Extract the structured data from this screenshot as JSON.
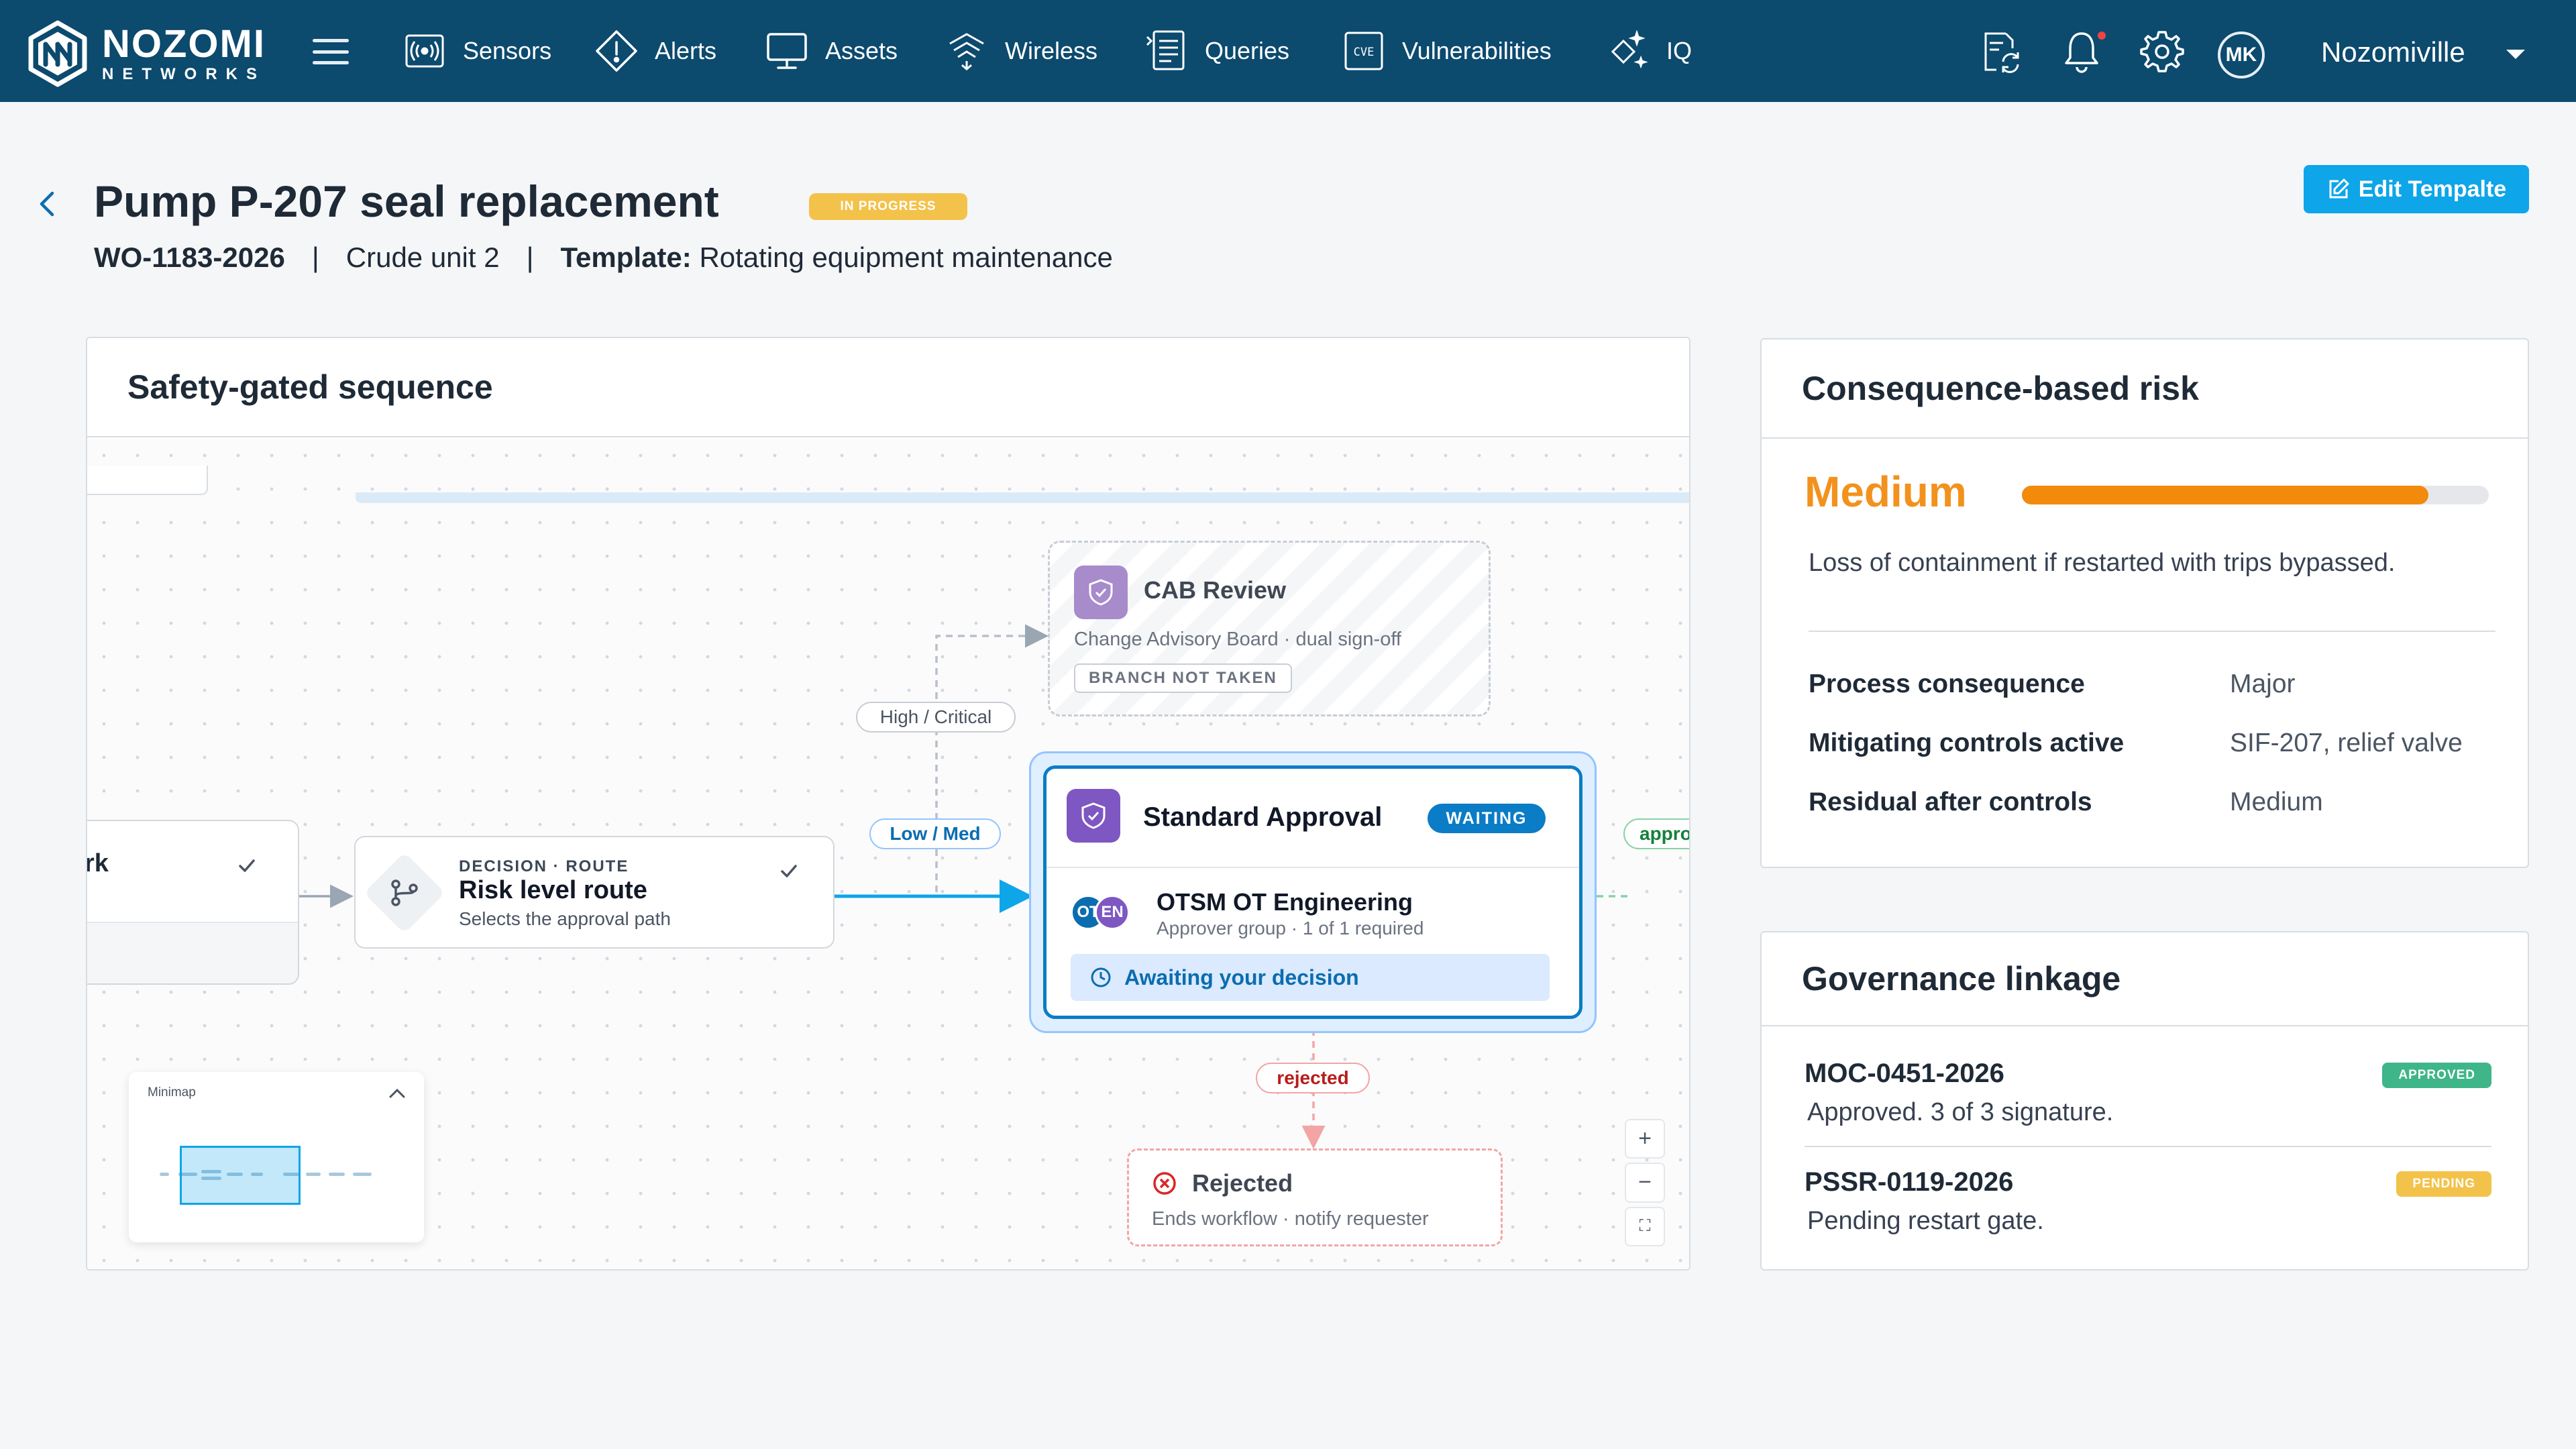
{
  "brand": {
    "name_top": "NOZOMI",
    "name_bottom": "NETWORKS"
  },
  "nav": {
    "items": [
      {
        "label": "Sensors",
        "icon": "sensor-icon"
      },
      {
        "label": "Alerts",
        "icon": "alert-icon"
      },
      {
        "label": "Assets",
        "icon": "monitor-icon"
      },
      {
        "label": "Wireless",
        "icon": "wireless-icon"
      },
      {
        "label": "Queries",
        "icon": "queries-icon"
      },
      {
        "label": "Vulnerabilities",
        "icon": "cve-icon"
      },
      {
        "label": "IQ",
        "icon": "iq-icon"
      }
    ],
    "cve_text": "CVE",
    "avatar_initials": "MK",
    "tenant": "Nozomiville"
  },
  "header": {
    "title": "Pump P-207 seal replacement",
    "status": "IN PROGRESS",
    "work_order": "WO-1183-2026",
    "unit": "Crude unit 2",
    "template_label": "Template:",
    "template_name": "Rotating equipment maintenance",
    "edit_button": "Edit Tempalte"
  },
  "flow": {
    "title": "Safety-gated sequence",
    "prev_node_label": "rk",
    "route_node": {
      "kicker": "DECISION · ROUTE",
      "title": "Risk level route",
      "subtitle": "Selects the approval path"
    },
    "cab_node": {
      "title": "CAB Review",
      "subtitle": "Change Advisory Board · dual sign-off",
      "badge": "BRANCH NOT TAKEN"
    },
    "approval_node": {
      "title": "Standard Approval",
      "status": "WAITING",
      "avatar_1": "OT",
      "avatar_2": "EN",
      "group": "OTSM OT Engineering",
      "group_sub": "Approver group · 1 of 1 required",
      "action": "Awaiting your decision"
    },
    "rejected_node": {
      "title": "Rejected",
      "subtitle": "Ends workflow · notify requester"
    },
    "edge_labels": {
      "high": "High / Critical",
      "low": "Low / Med",
      "rejected": "rejected",
      "approved": "appro"
    },
    "minimap_title": "Minimap",
    "zoom": {
      "in": "+",
      "out": "−",
      "fit": "⛶"
    }
  },
  "risk": {
    "title": "Consequence-based risk",
    "level": "Medium",
    "level_fraction": 0.87,
    "level_color": "#f28a0c",
    "description": "Loss of containment if restarted with trips bypassed.",
    "rows": [
      {
        "key": "Process consequence",
        "value": "Major"
      },
      {
        "key": "Mitigating controls active",
        "value": "SIF-207, relief valve"
      },
      {
        "key": "Residual after controls",
        "value": "Medium"
      }
    ]
  },
  "governance": {
    "title": "Governance linkage",
    "items": [
      {
        "id": "MOC-0451-2026",
        "description": "Approved. 3 of 3 signature.",
        "badge": "APPROVED",
        "badge_color": "#3fb58a"
      },
      {
        "id": "PSSR-0119-2026",
        "description": "Pending restart gate.",
        "badge": "PENDING",
        "badge_color": "#f3c24a"
      }
    ]
  }
}
